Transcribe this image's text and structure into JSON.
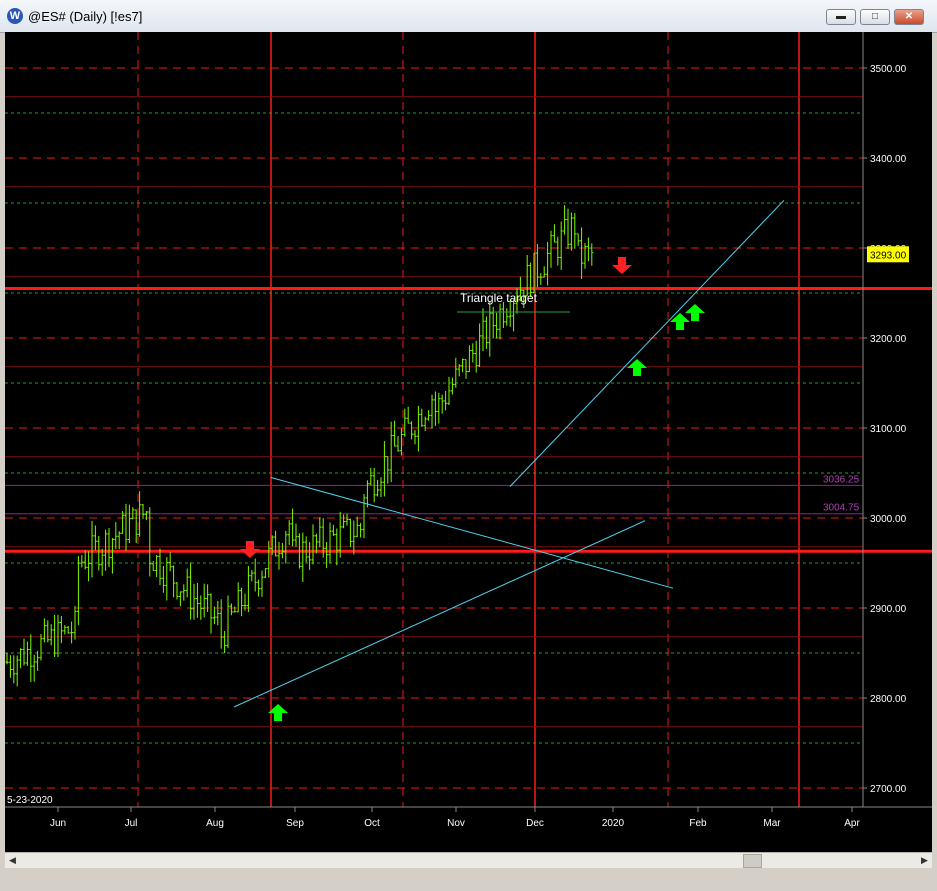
{
  "window": {
    "title": "@ES# (Daily) [!es7]",
    "app_icon": "W",
    "minimize_icon": "minimize-icon",
    "maximize_icon": "maximize-icon",
    "close_icon": "close-icon"
  },
  "colors": {
    "background": "#000000",
    "bars": "#7cfc00",
    "grid_red": "#e81c1c",
    "grid_green": "#1f9e2a",
    "trendline": "#4fd2f0",
    "price_label_bg": "#ffff00",
    "purple_line": "#9a1b9a",
    "up_arrow": "#00ff00",
    "down_arrow": "#ff2020"
  },
  "chart_data": {
    "type": "ohlc-bar",
    "symbol": "@ES#",
    "interval": "Daily",
    "date_label": "5-23-2020",
    "x_axis_labels": [
      "Jun",
      "Jul",
      "Aug",
      "Sep",
      "Oct",
      "Nov",
      "Dec",
      "2020",
      "Feb",
      "Mar",
      "Apr"
    ],
    "y_axis_labels": [
      "3500.00",
      "3400.00",
      "3300.00",
      "3200.00",
      "3100.00",
      "3000.00",
      "2900.00",
      "2800.00",
      "2700.00"
    ],
    "ylim": [
      2675,
      3565
    ],
    "last_price": "3293.00",
    "horizontal_levels": [
      {
        "label": "3036.25",
        "value": 3036.25
      },
      {
        "label": "3004.75",
        "value": 3004.75
      }
    ],
    "support_resistance": [
      3255,
      2963
    ],
    "annotation": "Triangle target",
    "monthly_path": [
      {
        "month": "Jun",
        "start": 2840,
        "end": 2880
      },
      {
        "month": "Jul",
        "start": 2950,
        "end": 3010
      },
      {
        "month": "Aug",
        "start": 2960,
        "end": 2880
      },
      {
        "month": "Sep",
        "start": 2870,
        "end": 3000
      },
      {
        "month": "Oct",
        "start": 2960,
        "end": 2990
      },
      {
        "month": "Nov",
        "start": 3030,
        "end": 3140
      },
      {
        "month": "Dec",
        "start": 3120,
        "end": 3240
      },
      {
        "month": "Jan",
        "start": 3240,
        "end": 3330
      },
      {
        "month": "Feb",
        "start": 3290,
        "end": 3293
      }
    ],
    "signals": {
      "up": [
        "2019-09-02",
        "2020-01-08",
        "2020-01-27",
        "2020-01-31"
      ],
      "down": [
        "2019-08-23",
        "2020-01-06"
      ]
    }
  }
}
